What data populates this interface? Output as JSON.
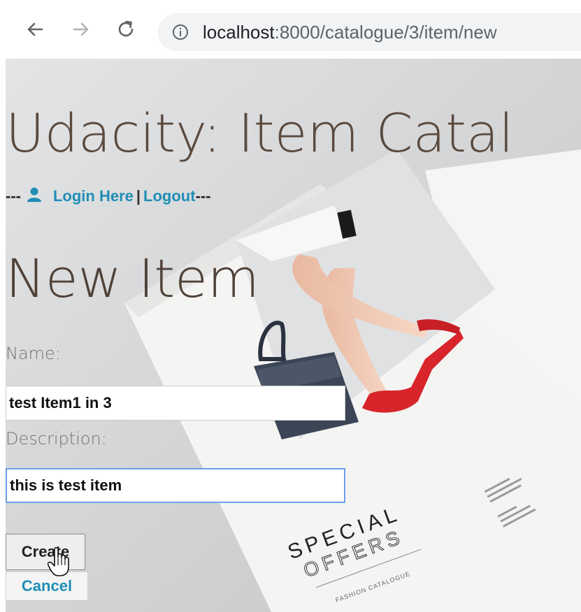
{
  "browser": {
    "url_host": "localhost",
    "url_path": ":8000/catalogue/3/item/new",
    "icons": [
      "back-arrow-icon",
      "forward-arrow-icon",
      "reload-icon",
      "info-icon"
    ]
  },
  "page": {
    "site_title": "Udacity: Item Catal",
    "nav": {
      "prefix": "---",
      "login_label": "Login Here",
      "separator": "|",
      "logout_label": "Logout",
      "suffix": "---",
      "user_icon": "user-icon"
    },
    "heading": "New Item",
    "form": {
      "name_label": "Name:",
      "name_value": "test Item1 in 3",
      "description_label": "Description:",
      "description_value": "this is test item",
      "create_label": "Create",
      "cancel_label": "Cancel"
    },
    "background_art": {
      "brand_line1": "SPECIAL",
      "brand_line2": "OFFERS",
      "small_caption": "FASHION CATALOGUE"
    }
  },
  "colors": {
    "link": "#1f8eb5",
    "heading": "#4f4137",
    "focus_border": "#6d9eeb"
  }
}
